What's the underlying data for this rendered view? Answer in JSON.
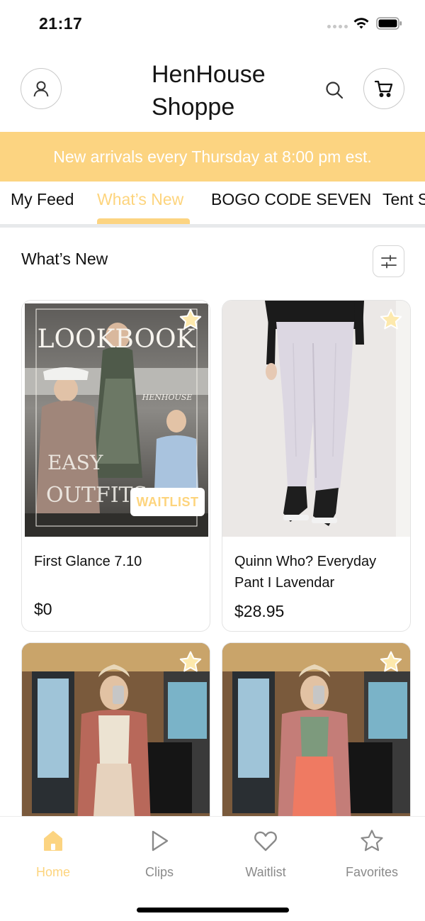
{
  "status_bar": {
    "time": "21:17"
  },
  "header": {
    "title": "HenHouse Shoppe",
    "profile_icon": "user-icon",
    "search_icon": "search-icon",
    "cart_icon": "cart-icon"
  },
  "banner": {
    "text": "New arrivals every Thursday at 8:00 pm est."
  },
  "tabs": [
    {
      "label": "My Feed"
    },
    {
      "label": "What’s New",
      "active": true
    },
    {
      "label": "BOGO CODE SEVEN"
    },
    {
      "label": "Tent Sale"
    }
  ],
  "section": {
    "title": "What’s New",
    "filter_icon": "sliders-icon"
  },
  "products": [
    {
      "name": "First Glance 7.10",
      "price": "$0",
      "badge": "WAITLIST",
      "image_text": [
        "LOOKBOOK",
        "EASY",
        "OUTFITS",
        "HENHOUSE"
      ]
    },
    {
      "name": "Quinn Who? Everyday Pant I Lavendar",
      "price": "$28.95"
    },
    {
      "name": "",
      "price": ""
    },
    {
      "name": "",
      "price": ""
    }
  ],
  "bottom_nav": [
    {
      "label": "Home",
      "icon": "home-icon",
      "active": true
    },
    {
      "label": "Clips",
      "icon": "play-icon"
    },
    {
      "label": "Waitlist",
      "icon": "heart-icon"
    },
    {
      "label": "Favorites",
      "icon": "star-icon"
    }
  ],
  "colors": {
    "accent": "#fcd481",
    "accent_text": "#fdd47d",
    "nav_inactive": "#8a8a8a"
  }
}
